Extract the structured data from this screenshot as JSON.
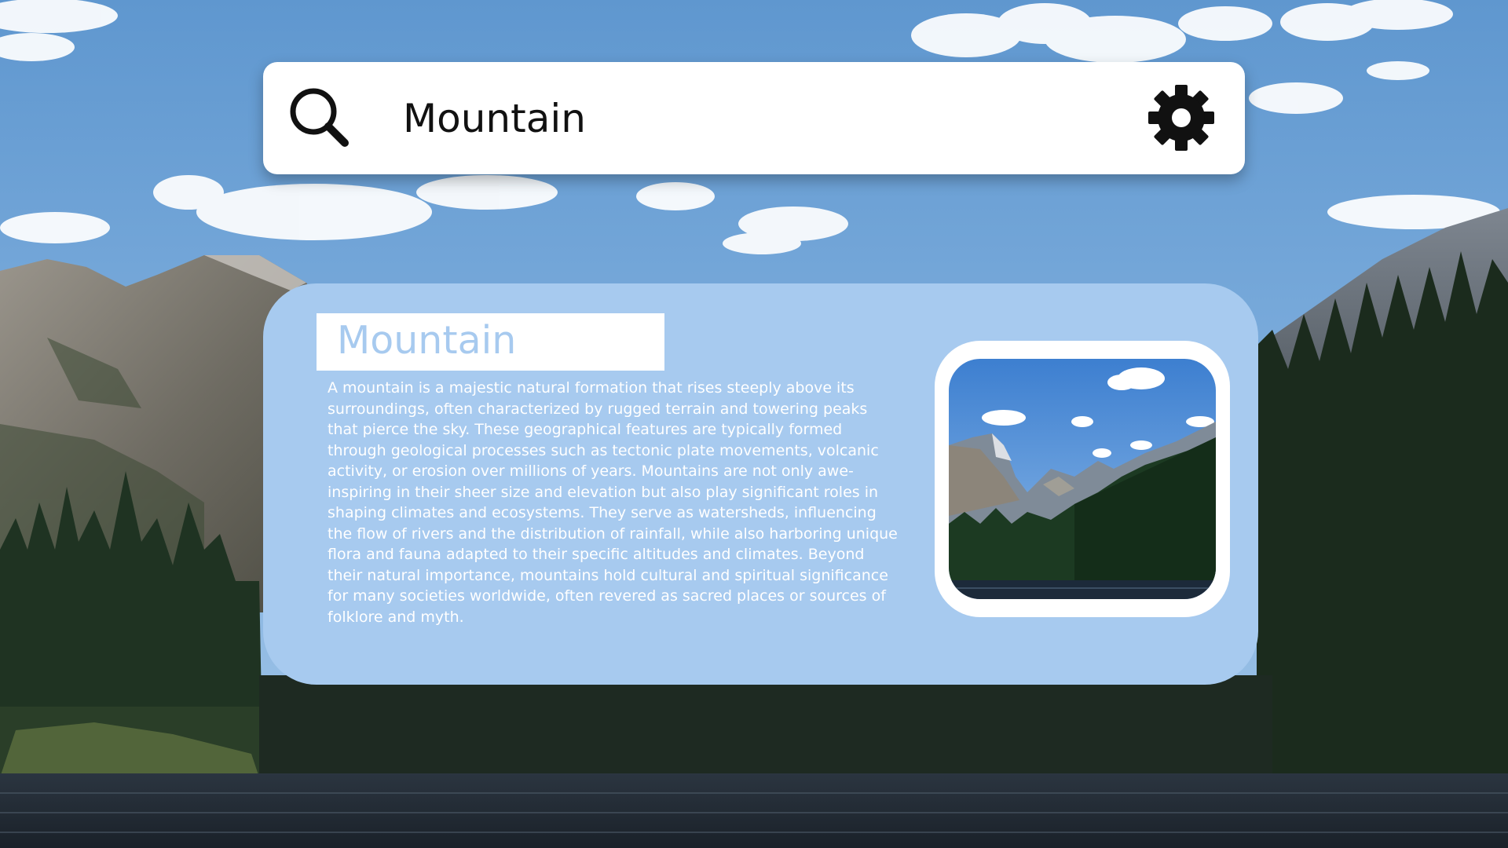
{
  "search": {
    "value": "Mountain",
    "icon": "search-icon",
    "settings_icon": "gear-icon"
  },
  "card": {
    "title": "Mountain",
    "body": "A mountain is a majestic natural formation that rises steeply above its surroundings, often characterized by rugged terrain and towering peaks that pierce the sky. These geographical features are typically formed through geological processes such as tectonic plate movements, volcanic activity, or erosion over millions of years. Mountains are not only awe-inspiring in their sheer size and elevation but also play significant roles in shaping climates and ecosystems. They serve as watersheds, influencing the flow of rivers and the distribution of rainfall, while also harboring unique flora and fauna adapted to their specific altitudes and climates. Beyond their natural importance, mountains hold cultural and spiritual significance for many societies worldwide, often revered as sacred places or sources of folklore and myth.",
    "image": "mountain-lake-photo"
  },
  "colors": {
    "card_background": "#a7caef",
    "title_text": "#a7caef",
    "body_text": "#ffffff",
    "search_background": "#ffffff"
  }
}
